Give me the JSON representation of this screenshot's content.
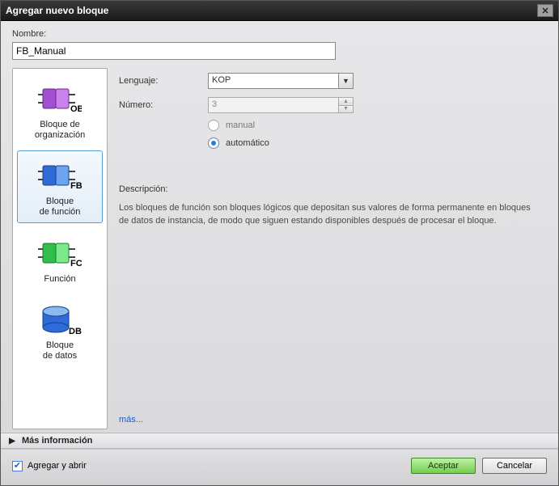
{
  "dialog": {
    "title": "Agregar nuevo bloque"
  },
  "name": {
    "label": "Nombre:",
    "value": "FB_Manual"
  },
  "sidebar": {
    "items": [
      {
        "tag": "OB",
        "label": "Bloque de\norganización",
        "color": "#a34fd1"
      },
      {
        "tag": "FB",
        "label": "Bloque\nde función",
        "color": "#3a7dd8"
      },
      {
        "tag": "FC",
        "label": "Función",
        "color": "#2fbf4a"
      },
      {
        "tag": "DB",
        "label": "Bloque\nde datos",
        "color": "#2f6bd8"
      }
    ],
    "selected_index": 1
  },
  "form": {
    "language_label": "Lenguaje:",
    "language_value": "KOP",
    "number_label": "Número:",
    "number_value": "3",
    "radios": {
      "manual": "manual",
      "automatic": "automático",
      "selected": "automatic"
    }
  },
  "description": {
    "label": "Descripción:",
    "text": "Los bloques de función son bloques lógicos que depositan sus valores de forma permanente en bloques de datos de instancia, de modo que siguen estando disponibles después de procesar el bloque."
  },
  "links": {
    "more": "más..."
  },
  "expand": {
    "label": "Más información"
  },
  "footer": {
    "checkbox_label": "Agregar y abrir",
    "checked": true,
    "accept": "Aceptar",
    "cancel": "Cancelar"
  }
}
